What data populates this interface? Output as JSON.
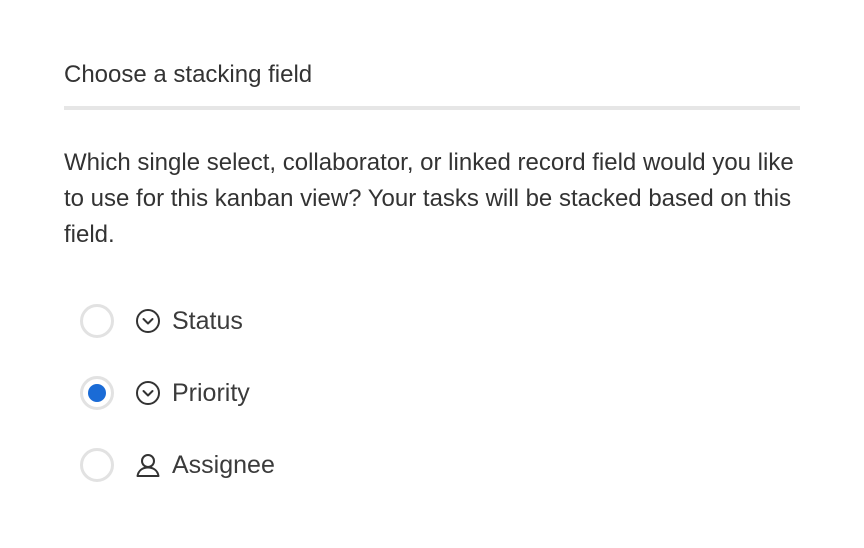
{
  "dialog": {
    "title": "Choose a stacking field",
    "description": "Which single select, collaborator, or linked record field would you like to use for this kanban view? Your tasks will be stacked based on this field."
  },
  "options": [
    {
      "label": "Status",
      "icon": "single-select-icon",
      "checked": false
    },
    {
      "label": "Priority",
      "icon": "single-select-icon",
      "checked": true
    },
    {
      "label": "Assignee",
      "icon": "user-icon",
      "checked": false
    }
  ],
  "colors": {
    "accent": "#1a6bd6",
    "divider": "#e6e6e6",
    "text": "#333333"
  }
}
